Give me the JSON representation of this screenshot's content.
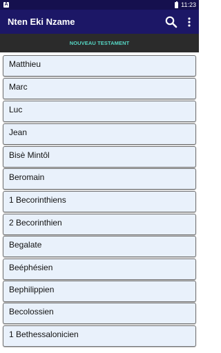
{
  "status_bar": {
    "time": "11:23",
    "left_icon": "A",
    "colors": {
      "background": "#15104e"
    }
  },
  "app_bar": {
    "title": "Nten Eki Nzame",
    "icons": [
      "search-icon",
      "more-vert-icon"
    ],
    "colors": {
      "background": "#1c1766"
    }
  },
  "tab": {
    "label": "NOUVEAU TESTAMENT",
    "colors": {
      "background": "#2b2b2b",
      "text": "#56d6c4"
    }
  },
  "books": [
    {
      "label": "Matthieu"
    },
    {
      "label": "Marc"
    },
    {
      "label": "Luc"
    },
    {
      "label": "Jean"
    },
    {
      "label": "Bisè Mintôl"
    },
    {
      "label": "Beromain"
    },
    {
      "label": "1 Becorinthiens"
    },
    {
      "label": "2 Becorinthien"
    },
    {
      "label": "Begalate"
    },
    {
      "label": "Beéphésien"
    },
    {
      "label": "Bephilippien"
    },
    {
      "label": "Becolossien"
    },
    {
      "label": "1 Bethessalonicien"
    }
  ],
  "item_colors": {
    "background": "#e9f1fb",
    "border": "#6f6f6f"
  }
}
